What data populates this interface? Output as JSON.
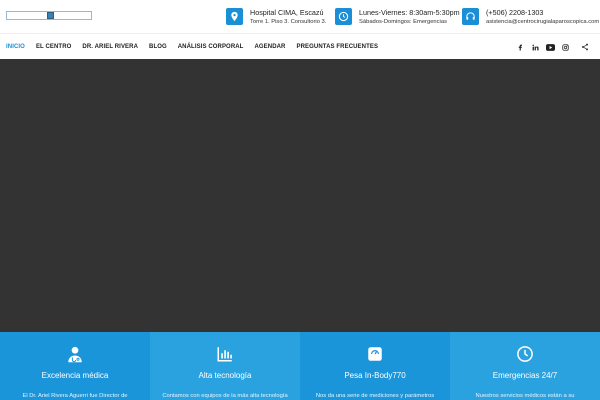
{
  "header": {
    "logo_text": "",
    "location": {
      "line1": "Hospital CIMA, Escazú",
      "line2": "Torre 1. Piso 3. Consultorio 3."
    },
    "hours": {
      "line1": "Lunes-Viernes: 8:30am-5:30pm",
      "line2": "Sábados-Domingos: Emergencias"
    },
    "contact": {
      "line1": "(+506) 2208-1303",
      "line2": "asistencia@centrocirugialaparoscopica.com"
    }
  },
  "nav": {
    "items": [
      "INICIO",
      "EL CENTRO",
      "DR. ARIEL RIVERA",
      "BLOG",
      "ANÁLISIS CORPORAL",
      "AGENDAR",
      "PREGUNTAS FRECUENTES"
    ],
    "active": "INICIO",
    "social": {
      "facebook": "f",
      "linkedin": "in",
      "youtube": "▶",
      "instagram": "◎"
    }
  },
  "colors": {
    "accent": "#1a8fd6",
    "hero_bg": "#333333",
    "feature_1": "#1b95da",
    "feature_2": "#2aa2e0",
    "feature_3": "#1b95da",
    "feature_4": "#2aa2e0"
  },
  "features": [
    {
      "icon": "doctor-icon",
      "title": "Excelencia médica",
      "desc": "El Dr. Ariel Rivera Aguerri fue Director de"
    },
    {
      "icon": "chart-icon",
      "title": "Alta tecnología",
      "desc": "Contamos con equipos de la más alta tecnología"
    },
    {
      "icon": "scale-icon",
      "title": "Pesa In-Body770",
      "desc": "Nos da una serie de mediciones y parámetros"
    },
    {
      "icon": "clock-icon",
      "title": "Emergencias 24/7",
      "desc": "Nuestros servicios médicos están a su"
    }
  ]
}
